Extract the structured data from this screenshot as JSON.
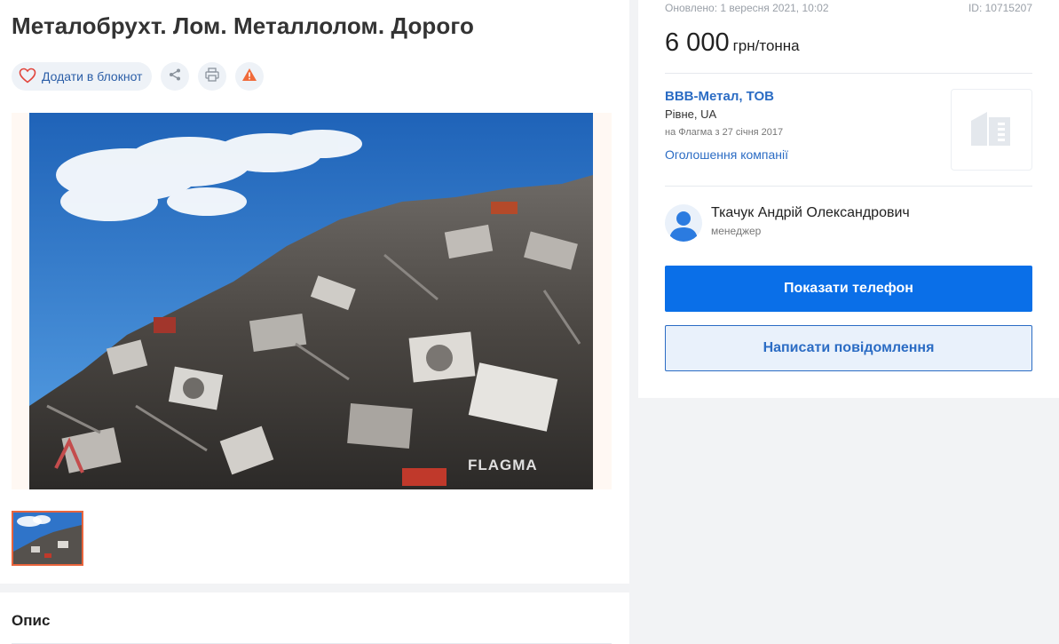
{
  "listing": {
    "title": "Металобрухт. Лом. Металлолом. Дорого",
    "add_to_notebook_label": "Додати в блокнот",
    "photo_watermark": "FLAGMA",
    "description_heading": "Опис"
  },
  "icons": {
    "heart": "heart-icon",
    "share": "share-icon",
    "print": "printer-icon",
    "report": "warning-icon",
    "company": "building-icon",
    "user": "user-icon"
  },
  "meta": {
    "updated": "Оновлено: 1 вересня 2021, 10:02",
    "id": "ID: 10715207"
  },
  "price": {
    "value": "6 000",
    "unit": "грн/тонна"
  },
  "company": {
    "name": "ВВВ-Метал, ТОВ",
    "city": "Рівне, UA",
    "since": "на Флагма з 27 січня 2017",
    "ads_link": "Оголошення компанії"
  },
  "contact": {
    "name": "Ткачук Андрій Олександрович",
    "role": "менеджер"
  },
  "buttons": {
    "show_phone": "Показати телефон",
    "write_message": "Написати повідомлення"
  },
  "colors": {
    "accent": "#0a6fe8",
    "link": "#2b6cc4",
    "warning": "#f06a3a",
    "thumb_border": "#e8643c"
  }
}
